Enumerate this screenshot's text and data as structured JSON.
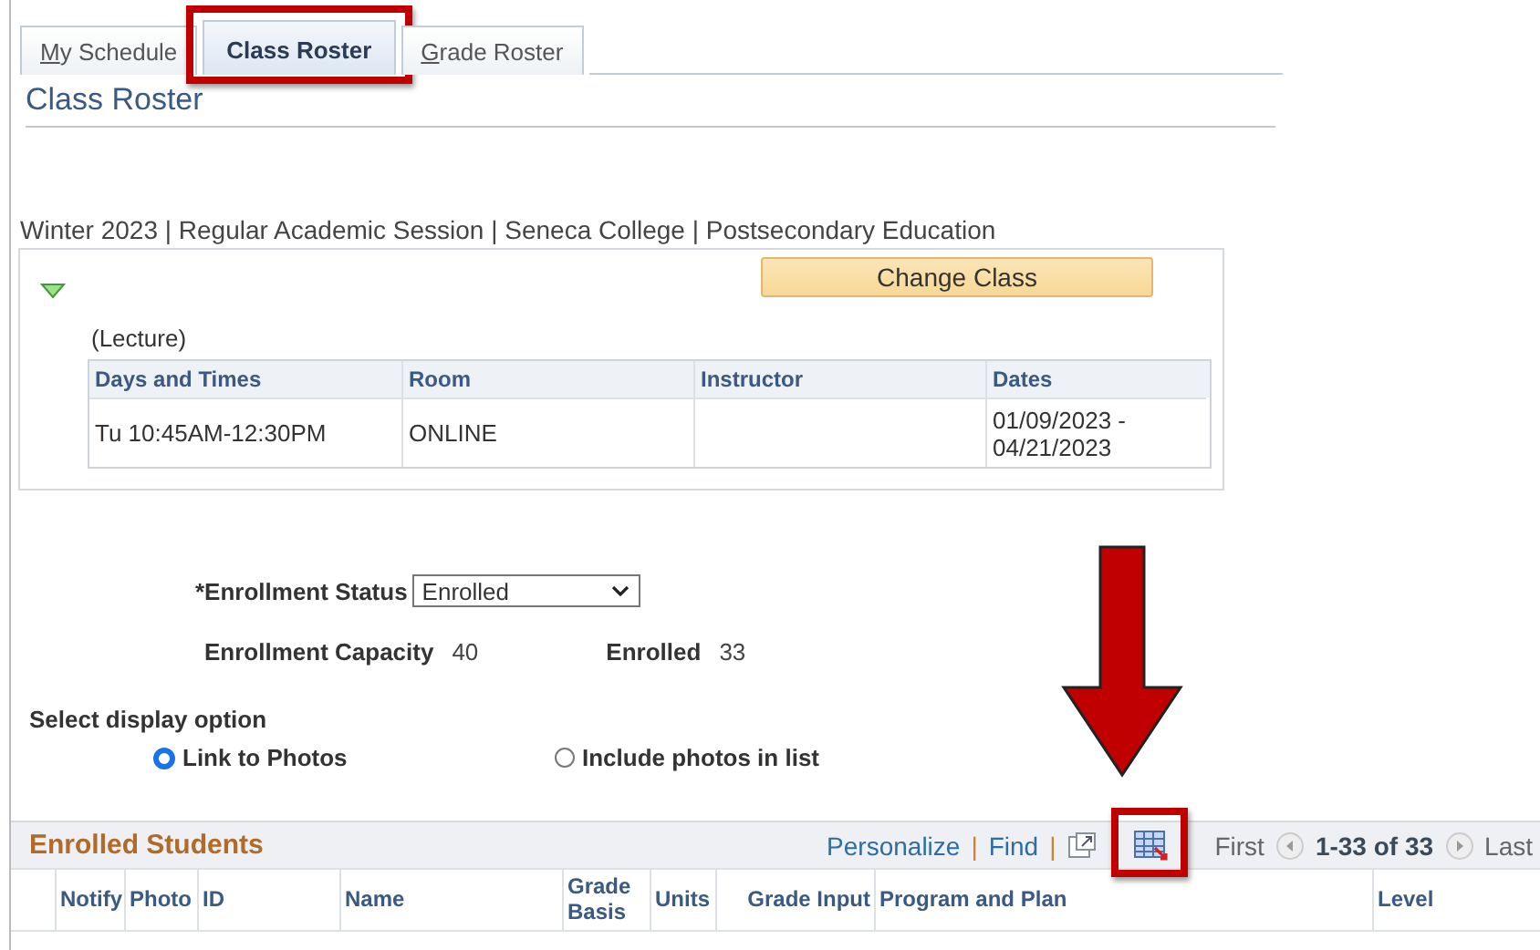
{
  "tabs": [
    {
      "label": "My Schedule",
      "access_key": true,
      "selected": false,
      "highlighted": false
    },
    {
      "label": "Class Roster",
      "access_key": false,
      "selected": true,
      "highlighted": true
    },
    {
      "label": "Grade Roster",
      "access_key": true,
      "selected": false,
      "highlighted": false
    }
  ],
  "page_title": "Class Roster",
  "term_line": "Winter 2023 | Regular Academic Session | Seneca College | Postsecondary Education",
  "class_section": {
    "expanded": true,
    "change_button": "Change Class",
    "component": "(Lecture)",
    "meeting_table": {
      "columns": [
        "Days and Times",
        "Room",
        "Instructor",
        "Dates"
      ],
      "rows": [
        [
          "Tu 10:45AM-12:30PM",
          "ONLINE",
          "",
          "01/09/2023 - 04/21/2023"
        ]
      ]
    }
  },
  "enrollment_status": {
    "label": "*Enrollment Status",
    "value": "Enrolled"
  },
  "capacity": {
    "label": "Enrollment Capacity",
    "value": "40"
  },
  "enrolled": {
    "label": "Enrolled",
    "value": "33"
  },
  "display_option": {
    "label": "Select display option",
    "options": [
      {
        "label": "Link to Photos",
        "selected": true
      },
      {
        "label": "Include photos in list",
        "selected": false
      }
    ]
  },
  "grid": {
    "title": "Enrolled Students",
    "personalize": "Personalize",
    "find": "Find",
    "separator": "|",
    "first": "First",
    "range": "1-33 of 33",
    "last": "Last",
    "download_highlighted": true,
    "columns": [
      "",
      "Notify",
      "Photo",
      "ID",
      "Name",
      "Grade Basis",
      "Units",
      "Grade Input",
      "Program and Plan",
      "Level"
    ]
  }
}
